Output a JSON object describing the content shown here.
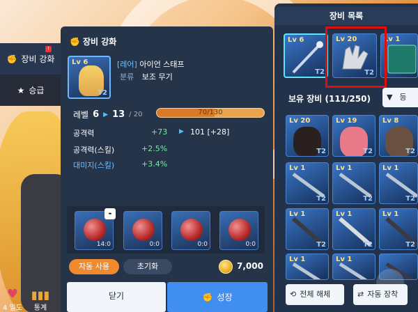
{
  "side_nav": {
    "items": [
      {
        "label": "장비 강화",
        "badge": "!",
        "icon": "fist-icon",
        "active": true
      },
      {
        "label": "승급",
        "icon": "star-icon",
        "active": false
      }
    ],
    "bottom": [
      {
        "label": "4 밀도",
        "icon": "heart-icon"
      },
      {
        "label": "통계",
        "icon": "bar-chart-icon"
      }
    ]
  },
  "panel": {
    "title": "장비 강화",
    "item": {
      "level": "Lv 6",
      "tier": "T2",
      "rarity": "[레어]",
      "name": "아이언 스태프",
      "category_label": "분류",
      "category": "보조 무기"
    },
    "level": {
      "label": "레벨",
      "current": "6",
      "next": "13",
      "max": "/ 20",
      "xp_text": "70/130",
      "xp_fraction": 0.538
    },
    "stats": [
      {
        "label": "공격력",
        "delta": "+73",
        "result": "101 [+28]"
      },
      {
        "label": "공격력(스킬)",
        "delta": "+2.5%"
      },
      {
        "label": "대미지(스킬)",
        "delta": "+3.4%"
      }
    ],
    "materials": [
      {
        "count": "14:0"
      },
      {
        "count": "0:0"
      },
      {
        "count": "0:0"
      },
      {
        "count": "0:0"
      }
    ],
    "minus_label": "-",
    "auto_use": "자동 사용",
    "reset": "초기화",
    "cost": "7,000",
    "close": "닫기",
    "grow": "성장"
  },
  "right": {
    "title": "장비 목록",
    "top_items": [
      {
        "level": "Lv 6",
        "tier": "T2",
        "type": "staff"
      },
      {
        "level": "Lv 20",
        "tier": "T2",
        "type": "gloves"
      },
      {
        "level": "Lv 1",
        "tier": "",
        "type": "book"
      }
    ],
    "owned_label": "보유 장비 (111/250)",
    "sort_label": "등",
    "grid": [
      {
        "level": "Lv 20",
        "tier": "T2"
      },
      {
        "level": "Lv 19",
        "tier": "T2"
      },
      {
        "level": "Lv 8",
        "tier": "T2"
      },
      {
        "level": "Lv 1",
        "tier": "T2"
      },
      {
        "level": "Lv 1",
        "tier": "T2"
      },
      {
        "level": "Lv 1",
        "tier": "T2"
      },
      {
        "level": "Lv 1",
        "tier": "T2"
      },
      {
        "level": "Lv 1",
        "tier": "T2"
      },
      {
        "level": "Lv 1",
        "tier": "T2"
      },
      {
        "level": "Lv 1",
        "tier": ""
      },
      {
        "level": "Lv 1",
        "tier": ""
      },
      {
        "level": "",
        "tier": ""
      }
    ],
    "dismantle_all": "전체 해체",
    "auto_equip": "자동 장착"
  }
}
